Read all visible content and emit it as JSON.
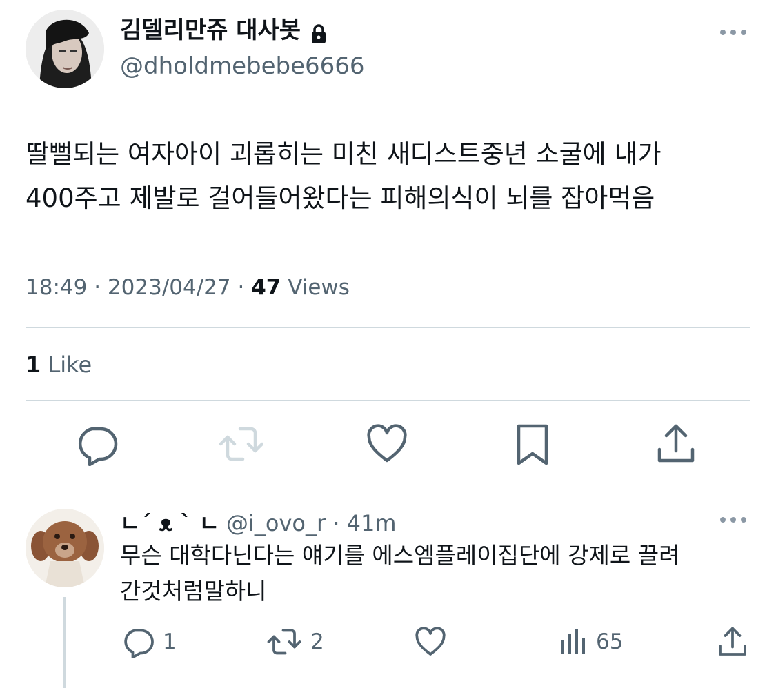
{
  "tweet": {
    "author": {
      "display_name": "김델리만쥬 대사봇",
      "handle": "@dholdmebebe6666",
      "protected_icon": "lock-icon",
      "avatar_icon": "profile-photo"
    },
    "text_lines": [
      "딸뻘되는 여자아이 괴롭히는 미친 새디스트중년 소굴에 내가",
      "400주고 제발로 걸어들어왔다는 피해의식이 뇌를 잡아먹음"
    ],
    "time": "18:49",
    "date": "2023/04/27",
    "views_count": "47",
    "views_label": "Views",
    "likes_count": "1",
    "likes_label": "Like",
    "actions": [
      "reply-icon",
      "retweet-icon",
      "like-icon",
      "bookmark-icon",
      "share-icon"
    ]
  },
  "reply": {
    "display_name": "ㄴ´ ᴥ ` ㄴ",
    "handle": "@i_ovo_r",
    "age": "41m",
    "text_lines": [
      "무슨 대학다닌다는 얘기를 에스엠플레이집단에 강제로 끌려",
      "간것처럼말하니"
    ],
    "reply_count": "1",
    "retweet_count": "2",
    "views_count": "65"
  },
  "colors": {
    "text": "#0f1419",
    "secondary": "#536471",
    "divider": "#cfd9de"
  }
}
